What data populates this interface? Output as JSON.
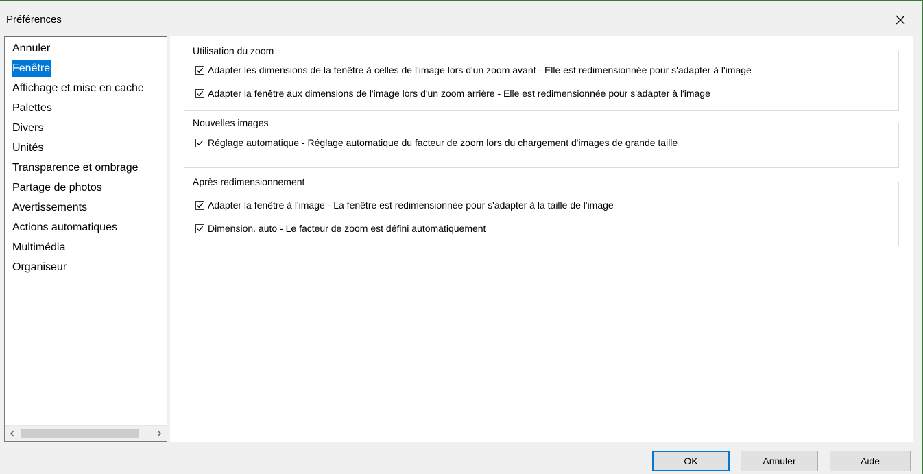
{
  "window": {
    "title": "Préférences"
  },
  "sidebar": {
    "items": [
      {
        "label": "Annuler"
      },
      {
        "label": "Fenêtre",
        "selected": true
      },
      {
        "label": "Affichage et mise en cache"
      },
      {
        "label": "Palettes"
      },
      {
        "label": "Divers"
      },
      {
        "label": "Unités"
      },
      {
        "label": "Transparence et ombrage"
      },
      {
        "label": "Partage de photos"
      },
      {
        "label": "Avertissements"
      },
      {
        "label": "Actions automatiques"
      },
      {
        "label": "Multimédia"
      },
      {
        "label": "Organiseur"
      }
    ],
    "scroll_left_icon": "chevron-left-icon",
    "scroll_right_icon": "chevron-right-icon"
  },
  "groups": {
    "zoom": {
      "title": "Utilisation du zoom",
      "options": [
        {
          "label": "Adapter les dimensions de la fenêtre à celles de l'image lors d'un zoom avant - Elle est redimensionnée pour s'adapter à l'image",
          "checked": true
        },
        {
          "label": "Adapter la fenêtre aux dimensions de l'image lors d'un zoom arrière - Elle est redimensionnée pour s'adapter à l'image",
          "checked": true
        }
      ]
    },
    "new_images": {
      "title": "Nouvelles images",
      "options": [
        {
          "label": "Réglage automatique - Réglage automatique du facteur de zoom lors du chargement d'images de grande taille",
          "checked": true
        }
      ]
    },
    "after_resize": {
      "title": "Après redimensionnement",
      "options": [
        {
          "label": "Adapter la fenêtre à l'image - La fenêtre est redimensionnée pour s'adapter à la taille de l'image",
          "checked": true
        },
        {
          "label": "Dimension. auto - Le facteur de zoom est défini automatiquement",
          "checked": true
        }
      ]
    }
  },
  "buttons": {
    "ok": "OK",
    "cancel": "Annuler",
    "help": "Aide"
  },
  "colors": {
    "selection": "#0078d7",
    "accent": "#3c7a3a"
  }
}
